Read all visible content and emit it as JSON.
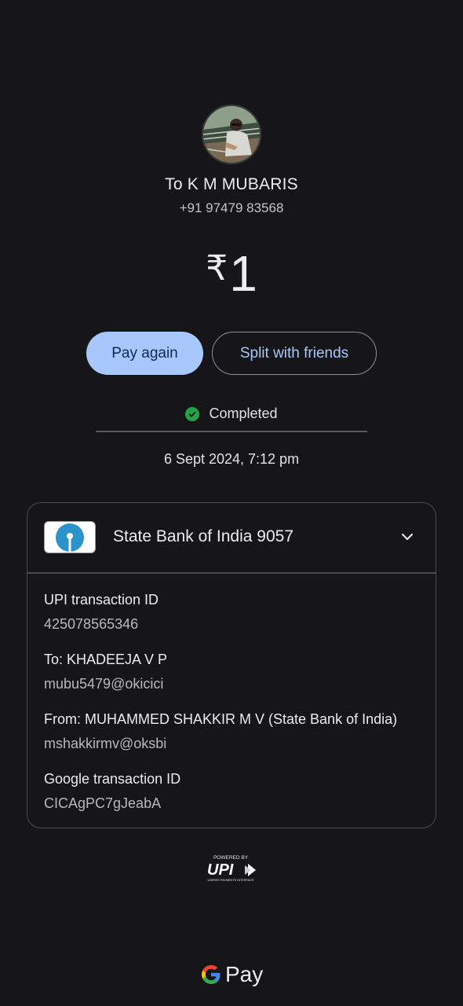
{
  "payee": {
    "name": "To K M MUBARIS",
    "phone": "+91 97479 83568"
  },
  "amount": {
    "currency_symbol": "₹",
    "value": "1"
  },
  "actions": {
    "pay_again": "Pay again",
    "split": "Split with friends"
  },
  "status": {
    "text": "Completed",
    "color": "#22a447"
  },
  "date": "6 Sept 2024, 7:12 pm",
  "bank": {
    "name": "State Bank of India 9057"
  },
  "details": {
    "upi_label": "UPI transaction ID",
    "upi_value": "425078565346",
    "to_label": "To: KHADEEJA V P",
    "to_value": "mubu5479@okicici",
    "from_label": "From: MUHAMMED SHAKKIR  M V (State Bank of India)",
    "from_value": "mshakkirmv@oksbi",
    "google_label": "Google transaction ID",
    "google_value": "CICAgPC7gJeabA"
  },
  "footer": {
    "powered_by": "POWERED BY",
    "upi_logo": "UPI",
    "upi_tagline": "UNIFIED PAYMENTS INTERFACE",
    "gpay_label": "Pay"
  },
  "colors": {
    "accent": "#a8c7fa",
    "background": "#161618"
  }
}
